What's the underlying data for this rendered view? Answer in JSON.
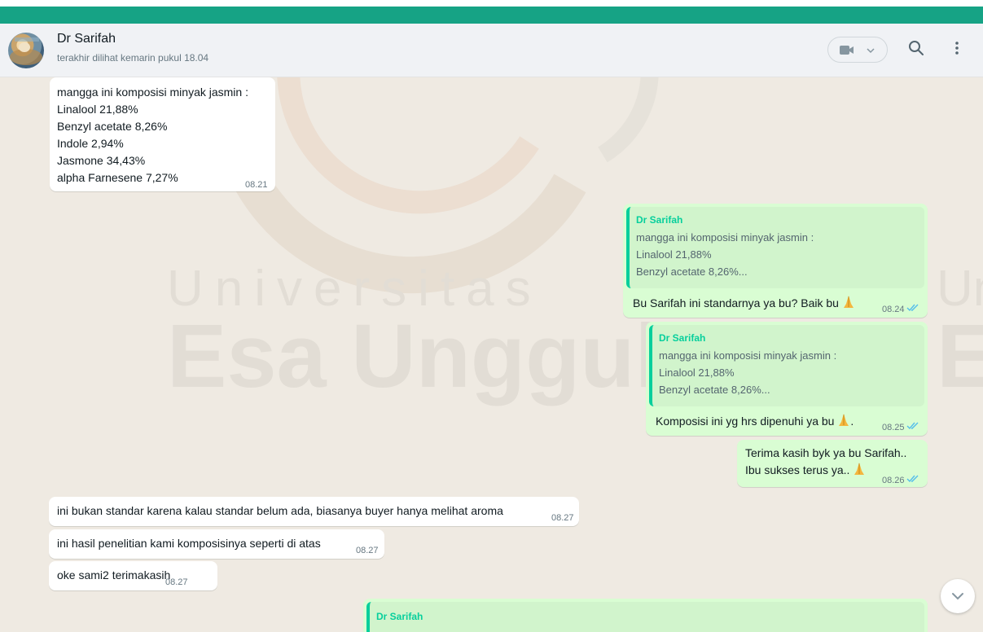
{
  "contact": {
    "name": "Dr Sarifah",
    "status": "terakhir dilihat kemarin pukul 18.04"
  },
  "header_icons": [
    "video-call-icon",
    "chevron-down-icon",
    "search-icon",
    "menu-icon"
  ],
  "watermark": {
    "line1": "Universitas",
    "line2": "Esa Unggul",
    "right1": "Un",
    "right2": "E"
  },
  "messages": [
    {
      "direction": "in",
      "lines": [
        "mangga ini komposisi minyak jasmin :",
        "Linalool 21,88%",
        "Benzyl acetate 8,26%",
        "Indole 2,94%",
        "Jasmone 34,43%",
        "alpha Farnesene 7,27%"
      ],
      "time": "08.21"
    },
    {
      "direction": "out",
      "quote": {
        "name": "Dr Sarifah",
        "lines": [
          "mangga ini komposisi minyak jasmin :",
          "Linalool 21,88%",
          "Benzyl acetate 8,26%..."
        ]
      },
      "text": "Bu Sarifah ini standarnya ya bu? Baik bu",
      "emoji": "folded-hands-emoji",
      "time": "08.24",
      "status": "read"
    },
    {
      "direction": "out",
      "quote": {
        "name": "Dr Sarifah",
        "lines": [
          "mangga ini komposisi minyak jasmin :",
          "Linalool 21,88%",
          "Benzyl acetate 8,26%..."
        ]
      },
      "text": "Komposisi ini yg hrs dipenuhi ya bu",
      "text_suffix": ".",
      "emoji": "folded-hands-emoji",
      "time": "08.25",
      "status": "read"
    },
    {
      "direction": "out",
      "lines": [
        "Terima kasih byk ya bu Sarifah..",
        "Ibu sukses terus ya.."
      ],
      "emoji": "folded-hands-emoji",
      "time": "08.26",
      "status": "read"
    },
    {
      "direction": "in",
      "text": "ini bukan standar karena kalau standar belum ada, biasanya buyer hanya melihat aroma",
      "time": "08.27"
    },
    {
      "direction": "in",
      "text": "ini hasil penelitian kami komposisinya seperti di atas",
      "time": "08.27"
    },
    {
      "direction": "in",
      "text": "oke sami2 terimakasih",
      "time": "08.27"
    },
    {
      "direction": "out",
      "quote": {
        "name": "Dr Sarifah"
      }
    }
  ],
  "colors": {
    "brand_green": "#16a385",
    "outgoing_bubble": "#d9fdd3",
    "incoming_bubble": "#ffffff",
    "quote_accent": "#06cf9c",
    "read_ticks": "#53bdeb",
    "chat_background": "#efeae2"
  }
}
